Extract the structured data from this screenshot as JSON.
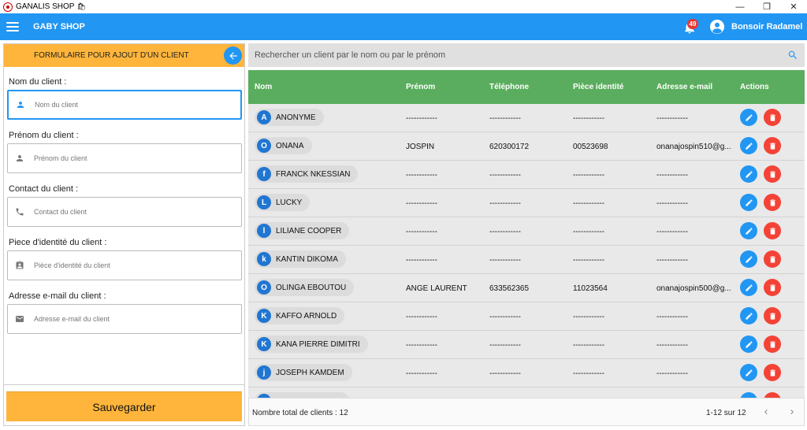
{
  "window": {
    "title": "GANALIS SHOP",
    "minimize": "—",
    "maximize": "❐",
    "close": "✕"
  },
  "appbar": {
    "shop_name": "GABY SHOP",
    "notification_count": "49",
    "greeting": "Bonsoir Radamel"
  },
  "form": {
    "title": "FORMULAIRE POUR AJOUT D'UN CLIENT",
    "fields": [
      {
        "label": "Nom du client :",
        "placeholder": "Nom du client",
        "icon": "person-icon"
      },
      {
        "label": "Prénom du client :",
        "placeholder": "Prénom du client",
        "icon": "person-icon"
      },
      {
        "label": "Contact du client :",
        "placeholder": "Contact du client",
        "icon": "phone-icon"
      },
      {
        "label": "Piece d'identité du client :",
        "placeholder": "Pièce d'identité du client",
        "icon": "id-card-icon"
      },
      {
        "label": "Adresse e-mail du client :",
        "placeholder": "Adresse e-mail du client",
        "icon": "mail-icon"
      }
    ],
    "save_label": "Sauvegarder"
  },
  "search": {
    "placeholder": "Rechercher un client par le nom ou par le prénom"
  },
  "table": {
    "columns": [
      "Nom",
      "Prénom",
      "Téléphone",
      "Pièce identité",
      "Adresse e-mail",
      "Actions"
    ],
    "rows": [
      {
        "initial": "A",
        "name": "ANONYME",
        "prenom": "------------",
        "tel": "------------",
        "piece": "------------",
        "email": "------------"
      },
      {
        "initial": "O",
        "name": "ONANA",
        "prenom": "JOSPIN",
        "tel": "620300172",
        "piece": "00523698",
        "email": "onanajospin510@g..."
      },
      {
        "initial": "f",
        "name": "FRANCK NKESSIAN",
        "prenom": "------------",
        "tel": "------------",
        "piece": "------------",
        "email": "------------"
      },
      {
        "initial": "L",
        "name": "LUCKY",
        "prenom": "------------",
        "tel": "------------",
        "piece": "------------",
        "email": "------------"
      },
      {
        "initial": "l",
        "name": "LILIANE COOPER",
        "prenom": "------------",
        "tel": "------------",
        "piece": "------------",
        "email": "------------"
      },
      {
        "initial": "k",
        "name": "KANTIN DIKOMA",
        "prenom": "------------",
        "tel": "------------",
        "piece": "------------",
        "email": "------------"
      },
      {
        "initial": "O",
        "name": "OLINGA EBOUTOU",
        "prenom": "ANGE LAURENT",
        "tel": "633562365",
        "piece": "11023564",
        "email": "onanajospin500@g..."
      },
      {
        "initial": "K",
        "name": "KAFFO ARNOLD",
        "prenom": "------------",
        "tel": "------------",
        "piece": "------------",
        "email": "------------"
      },
      {
        "initial": "K",
        "name": "KANA PIERRE DIMITRI",
        "prenom": "------------",
        "tel": "------------",
        "piece": "------------",
        "email": "------------"
      },
      {
        "initial": "j",
        "name": "JOSEPH KAMDEM",
        "prenom": "------------",
        "tel": "------------",
        "piece": "------------",
        "email": "------------"
      },
      {
        "initial": "",
        "name": "",
        "prenom": "",
        "tel": "",
        "piece": "",
        "email": ""
      }
    ]
  },
  "footer": {
    "total": "Nombre total de clients : 12",
    "range": "1-12 sur 12"
  },
  "colors": {
    "primary": "#2196f3",
    "accent": "#ffb53b",
    "header_green": "#5aad5e",
    "delete": "#f44336"
  }
}
